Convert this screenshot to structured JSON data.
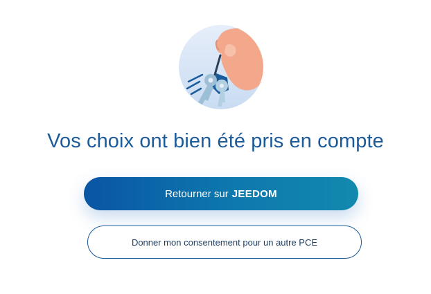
{
  "illustration": {
    "icon": "hand-holding-keys-icon",
    "colors": {
      "circle_bg": "#d7e6f7",
      "hand": "#f3a88c",
      "keys": "#9dbfd6",
      "key_tag": "#1c5b9a"
    }
  },
  "confirmation": {
    "title": "Vos choix ont bien été pris en compte"
  },
  "actions": {
    "return_prefix": "Retourner sur",
    "return_target": "JEEDOM",
    "consent_other": "Donner mon consentement pour un autre PCE"
  },
  "colors": {
    "title": "#1c5b9a",
    "primary_gradient_start": "#0a55a4",
    "primary_gradient_end": "#1389ae",
    "secondary_border": "#1c5b9a"
  }
}
